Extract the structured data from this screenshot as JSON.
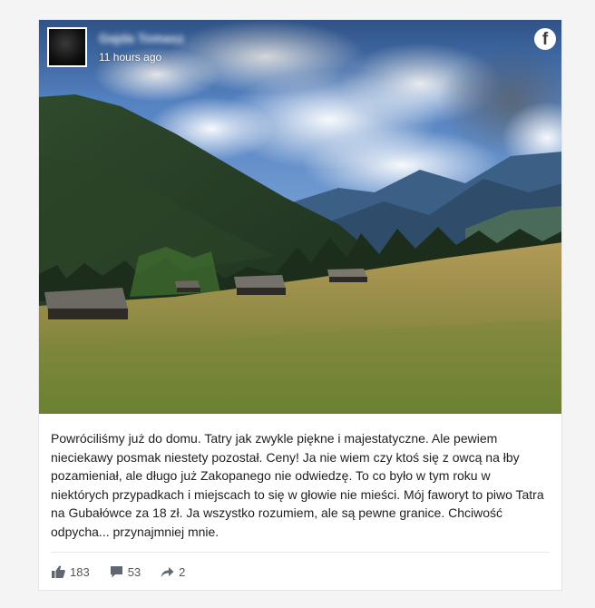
{
  "post": {
    "author_name": "Gajda Tomasz",
    "timestamp": "11 hours ago",
    "platform_icon": "facebook-icon",
    "text": "Powróciliśmy już do domu. Tatry jak zwykle piękne i majestatyczne. Ale pewiem nieciekawy posmak niestety pozostał. Ceny! Ja nie wiem czy ktoś się z owcą na łby pozamieniał, ale długo już Zakopanego nie odwiedzę. To co było w tym roku w niektórych przypadkach i miejscach to się w głowie nie mieści. Mój faworyt to piwo Tatra na Gubałówce za 18 zł. Ja wszystko rozumiem, ale są pewne granice. Chciwość odpycha... przynajmniej mnie.",
    "stats": {
      "likes": "183",
      "comments": "53",
      "shares": "2"
    }
  },
  "colors": {
    "text": "#1c1e21",
    "stat_text": "#555555",
    "card_bg": "#ffffff",
    "page_bg": "#f4f4f4"
  }
}
